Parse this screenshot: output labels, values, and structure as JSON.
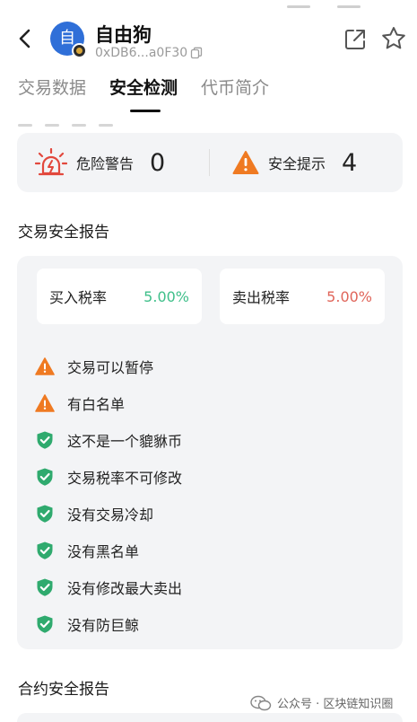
{
  "header": {
    "token_name": "自由狗",
    "avatar_char": "自",
    "address": "0xDB6...a0F30"
  },
  "tabs": [
    {
      "label": "交易数据",
      "active": false
    },
    {
      "label": "安全检测",
      "active": true
    },
    {
      "label": "代币简介",
      "active": false
    }
  ],
  "summary": {
    "danger_label": "危险警告",
    "danger_count": "0",
    "safety_label": "安全提示",
    "safety_count": "4"
  },
  "trade_report": {
    "title": "交易安全报告",
    "buy_tax_label": "买入税率",
    "buy_tax_value": "5.00%",
    "sell_tax_label": "卖出税率",
    "sell_tax_value": "5.00%",
    "checks": [
      {
        "text": "交易可以暂停",
        "status": "warning"
      },
      {
        "text": "有白名单",
        "status": "warning"
      },
      {
        "text": "这不是一个貔貅币",
        "status": "safe"
      },
      {
        "text": "交易税率不可修改",
        "status": "safe"
      },
      {
        "text": "没有交易冷却",
        "status": "safe"
      },
      {
        "text": "没有黑名单",
        "status": "safe"
      },
      {
        "text": "没有修改最大卖出",
        "status": "safe"
      },
      {
        "text": "没有防巨鲸",
        "status": "safe"
      }
    ]
  },
  "contract_report": {
    "title": "合约安全报告"
  },
  "watermark": {
    "text": "公众号 · 区块链知识圈"
  },
  "colors": {
    "warning": "#ef7a22",
    "safe": "#2faa6e",
    "alarm": "#e2483d",
    "buy_tax": "#3fbf8a",
    "sell_tax": "#e0655a",
    "card_bg": "#f3f4f6"
  },
  "icons": {
    "back": "chevron-left-icon",
    "copy": "copy-icon",
    "share": "share-icon",
    "favorite": "star-icon",
    "danger": "alarm-siren-icon",
    "safety": "warning-triangle-icon",
    "check_safe": "shield-check-icon",
    "check_warning": "warning-triangle-icon"
  }
}
